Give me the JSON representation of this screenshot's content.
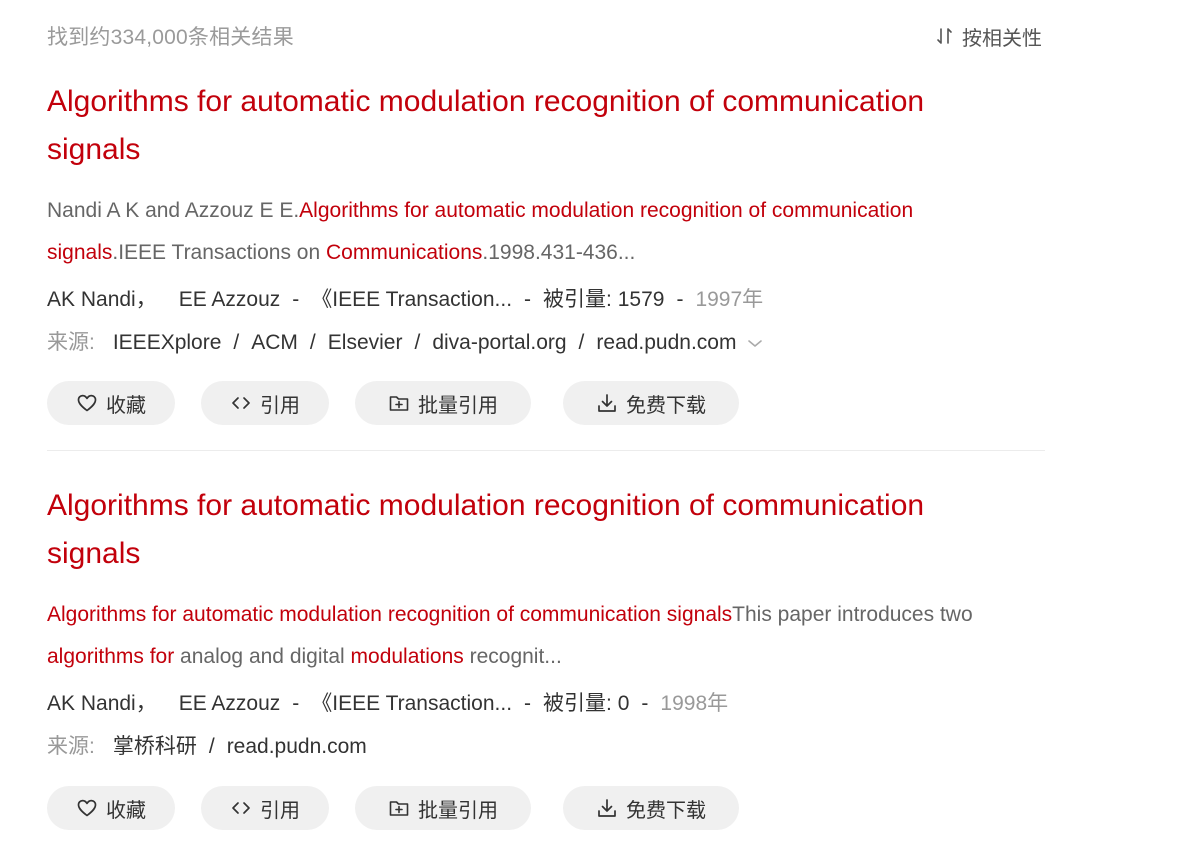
{
  "header": {
    "result_count": "找到约334,000条相关结果",
    "sort_label": "按相关性"
  },
  "icons": {
    "sort": "sort-icon",
    "favorite": "heart-icon",
    "cite": "code-icon",
    "batch_cite": "folder-plus-icon",
    "download": "download-icon",
    "expand": "chevron-down-icon"
  },
  "colors": {
    "title": "#c2000b",
    "highlight": "#c2000b",
    "muted": "#999999",
    "button_bg": "#f0f0f0"
  },
  "results": [
    {
      "title_line1": "Algorithms for automatic modulation recognition of communication",
      "title_line2": "signals",
      "snippet": [
        {
          "text": "Nandi A K and Azzouz E E.",
          "hl": false
        },
        {
          "text": "Algorithms for automatic modulation recognition of communication signals",
          "hl": true
        },
        {
          "text": ".IEEE Transactions on ",
          "hl": false
        },
        {
          "text": "Communications",
          "hl": true
        },
        {
          "text": ".1998.431-436...",
          "hl": false
        }
      ],
      "author1": "AK Nandi",
      "comma": "，",
      "author2": "EE Azzouz",
      "dash": "-",
      "journal": "《IEEE Transaction...",
      "cited_label": "被引量:",
      "cited_count": "1579",
      "year": "1997年",
      "source_label": "来源:",
      "sources": [
        "IEEEXplore",
        "ACM",
        "Elsevier",
        "diva-portal.org",
        "read.pudn.com"
      ],
      "slash": "/",
      "has_more_sources": true,
      "actions": {
        "favorite": "收藏",
        "cite": "引用",
        "batch_cite": "批量引用",
        "download": "免费下载"
      }
    },
    {
      "title_line1": "Algorithms for automatic modulation recognition of communication",
      "title_line2": "signals",
      "snippet": [
        {
          "text": "Algorithms for automatic modulation recognition of communication signals",
          "hl": true
        },
        {
          "text": "This paper introduces two ",
          "hl": false
        },
        {
          "text": "algorithms for",
          "hl": true
        },
        {
          "text": " analog and digital ",
          "hl": false
        },
        {
          "text": "modulations",
          "hl": true
        },
        {
          "text": " recognit...",
          "hl": false
        }
      ],
      "author1": "AK Nandi",
      "comma": "，",
      "author2": "EE Azzouz",
      "dash": "-",
      "journal": "《IEEE Transaction...",
      "cited_label": "被引量:",
      "cited_count": "0",
      "year": "1998年",
      "source_label": "来源:",
      "sources": [
        "掌桥科研",
        "read.pudn.com"
      ],
      "slash": "/",
      "has_more_sources": false,
      "actions": {
        "favorite": "收藏",
        "cite": "引用",
        "batch_cite": "批量引用",
        "download": "免费下载"
      }
    }
  ]
}
